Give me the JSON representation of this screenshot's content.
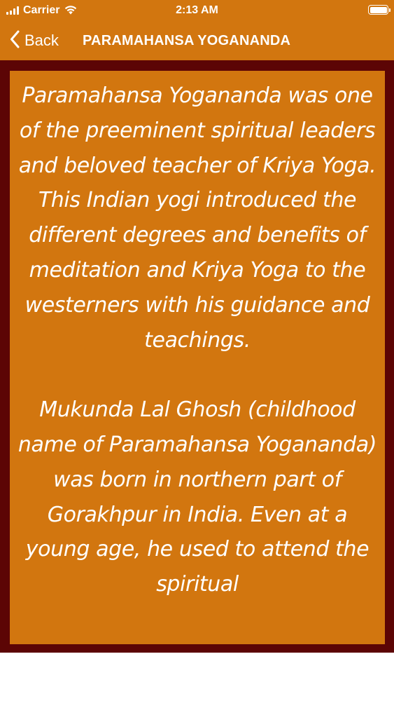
{
  "status_bar": {
    "carrier": "Carrier",
    "time": "2:13 AM"
  },
  "nav": {
    "back_label": "Back",
    "title": "PARAMAHANSA YOGANANDA"
  },
  "content": {
    "paragraphs": [
      "Paramahansa Yogananda was one of the preeminent spiritual leaders and beloved teacher of Kriya Yoga. This Indian yogi introduced the different degrees and benefits of meditation and Kriya Yoga to the westerners with his guidance and teachings.",
      "Mukunda Lal Ghosh (childhood name of Paramahansa Yogananda) was born in northern part of Gorakhpur in India. Even at a young age, he used to attend the spiritual"
    ]
  },
  "colors": {
    "header_bg": "#d2760f",
    "frame_bg": "#5c0505",
    "content_bg": "#d2760f",
    "text": "#ffffff"
  },
  "icons": {
    "signal": "cellular-signal-icon",
    "wifi": "wifi-icon",
    "battery": "battery-icon",
    "back": "chevron-left-icon"
  }
}
